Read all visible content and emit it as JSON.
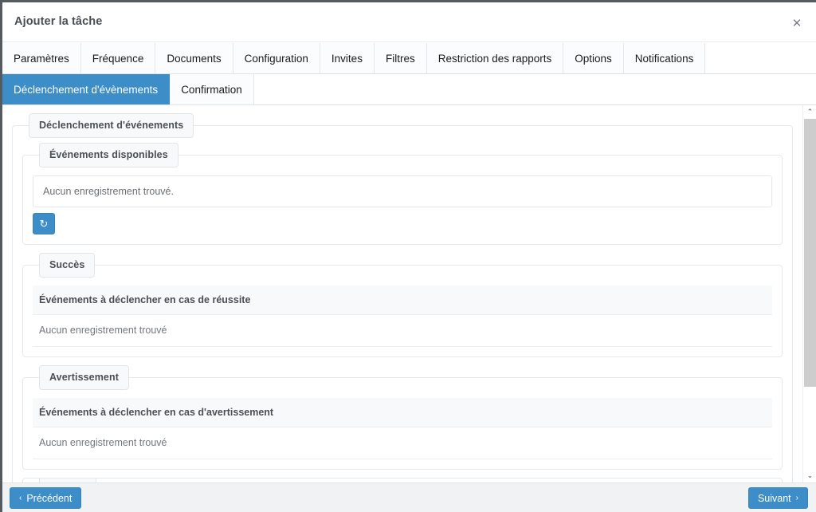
{
  "dialog": {
    "title": "Ajouter la tâche",
    "close_icon": "close-icon",
    "close_glyph": "✕"
  },
  "tabs": {
    "row1": [
      {
        "label": "Paramètres",
        "active": false
      },
      {
        "label": "Fréquence",
        "active": false
      },
      {
        "label": "Documents",
        "active": false
      },
      {
        "label": "Configuration",
        "active": false
      },
      {
        "label": "Invites",
        "active": false
      },
      {
        "label": "Filtres",
        "active": false
      },
      {
        "label": "Restriction des rapports",
        "active": false
      },
      {
        "label": "Options",
        "active": false
      },
      {
        "label": "Notifications",
        "active": false
      }
    ],
    "row2": [
      {
        "label": "Déclenchement d'évènements",
        "active": true
      },
      {
        "label": "Confirmation",
        "active": false
      }
    ]
  },
  "content": {
    "outer_legend": "Déclenchement d'événements",
    "available": {
      "legend": "Événements disponibles",
      "empty_text": "Aucun enregistrement trouvé.",
      "refresh_icon": "refresh-icon",
      "refresh_glyph": "↻"
    },
    "success": {
      "legend": "Succès",
      "header": "Événements à déclencher en cas de réussite",
      "empty_text": "Aucun enregistrement trouvé"
    },
    "warning": {
      "legend": "Avertissement",
      "header": "Événements à déclencher en cas d'avertissement",
      "empty_text": "Aucun enregistrement trouvé"
    }
  },
  "scrollbar": {
    "up_glyph": "⌃",
    "down_glyph": "⌄"
  },
  "footer": {
    "prev_label": "Précédent",
    "prev_chevron": "‹",
    "next_label": "Suivant",
    "next_chevron": "›"
  },
  "colors": {
    "accent": "#3d8dc8",
    "header_text": "#4a4f55",
    "muted_text": "#73787d",
    "footer_bg": "#f1f2f3",
    "scroll_thumb": "#cdcdcd"
  }
}
